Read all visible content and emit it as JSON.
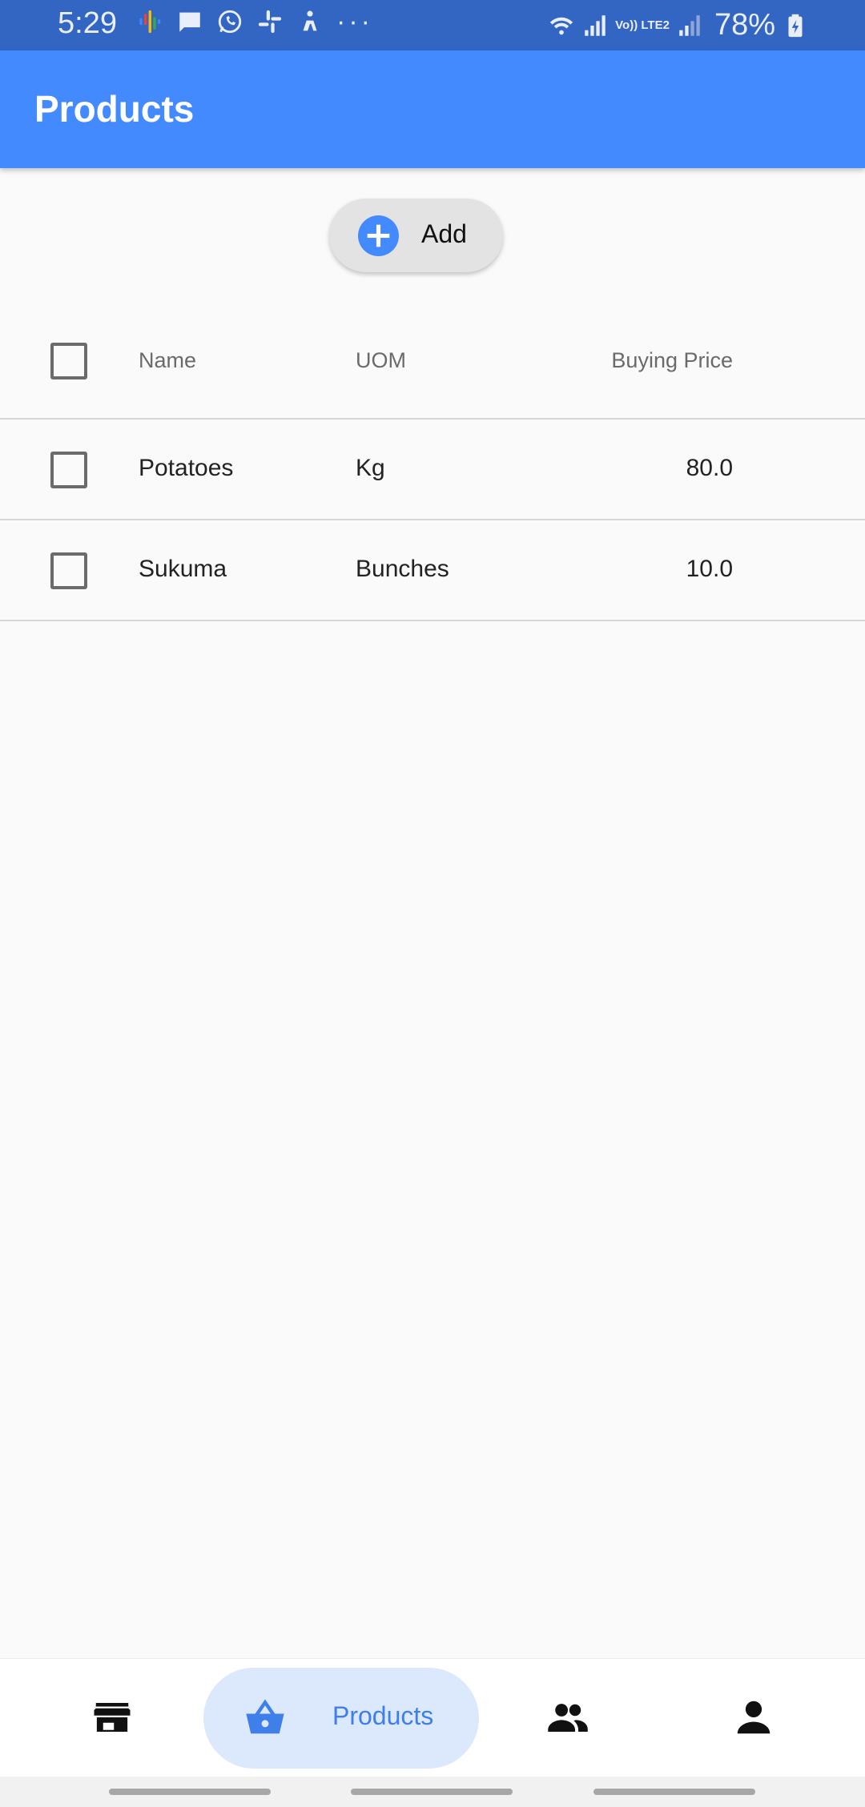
{
  "status_bar": {
    "time": "5:29",
    "battery": "78%",
    "network_label": "Vo)) LTE2",
    "icons": [
      "podcast-icon",
      "message-icon",
      "whatsapp-icon",
      "slack-icon",
      "fitness-icon",
      "more-dots-icon",
      "wifi-icon",
      "signal-icon",
      "signal-icon",
      "battery-charging-icon"
    ],
    "more": "···"
  },
  "app_bar": {
    "title": "Products",
    "color": "#448aff"
  },
  "add_button": {
    "label": "Add",
    "icon": "add-circle-icon"
  },
  "table": {
    "columns": [
      "Name",
      "UOM",
      "Buying Price"
    ],
    "rows": [
      {
        "name": "Potatoes",
        "uom": "Kg",
        "buying_price": "80.0",
        "selected": false
      },
      {
        "name": "Sukuma",
        "uom": "Bunches",
        "buying_price": "10.0",
        "selected": false
      }
    ]
  },
  "bottom_nav": {
    "items": [
      {
        "icon": "store-icon",
        "label": "",
        "active": false
      },
      {
        "icon": "basket-icon",
        "label": "Products",
        "active": true
      },
      {
        "icon": "people-icon",
        "label": "",
        "active": false
      },
      {
        "icon": "person-icon",
        "label": "",
        "active": false
      }
    ],
    "active_color": "#3f7fe9"
  }
}
